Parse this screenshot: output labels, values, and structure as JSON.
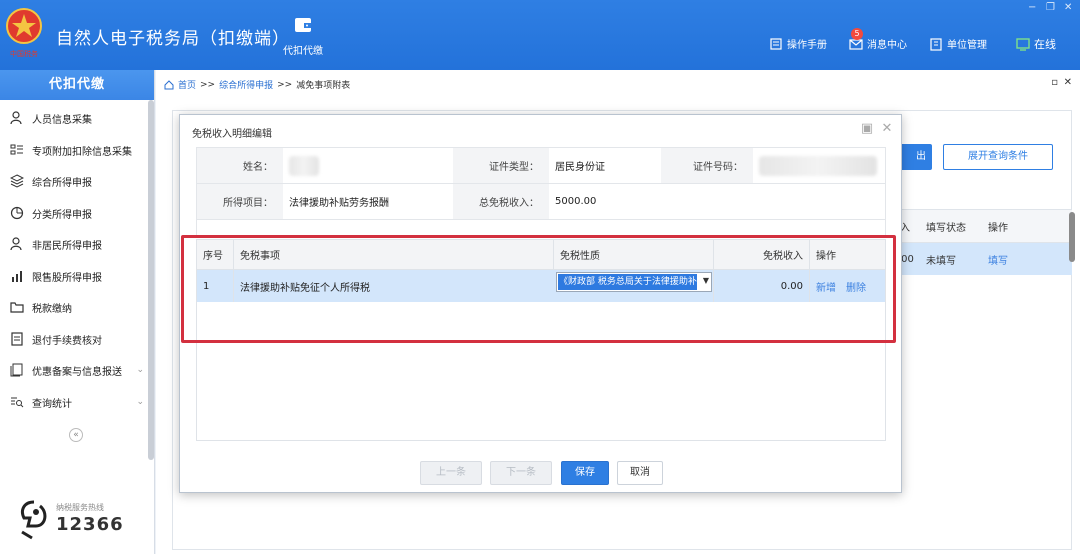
{
  "app": {
    "title": "自然人电子税务局（扣缴端）",
    "module": "代扣代缴",
    "emblem_text": "中国税务"
  },
  "header_links": [
    {
      "label": "操作手册",
      "icon": "book-icon"
    },
    {
      "label": "消息中心",
      "icon": "mail-icon",
      "badge": "5"
    },
    {
      "label": "单位管理",
      "icon": "building-icon"
    },
    {
      "label": "在线",
      "icon": "online-status-icon"
    }
  ],
  "sidebar": {
    "title": "代扣代缴",
    "items": [
      {
        "label": "人员信息采集",
        "icon": "person-icon"
      },
      {
        "label": "专项附加扣除信息采集",
        "icon": "list-icon"
      },
      {
        "label": "综合所得申报",
        "icon": "layers-icon"
      },
      {
        "label": "分类所得申报",
        "icon": "pie-icon"
      },
      {
        "label": "非居民所得申报",
        "icon": "person-icon"
      },
      {
        "label": "限售股所得申报",
        "icon": "chart-icon"
      },
      {
        "label": "税款缴纳",
        "icon": "folder-icon"
      },
      {
        "label": "退付手续费核对",
        "icon": "doc-icon"
      },
      {
        "label": "优惠备案与信息报送",
        "icon": "doc-stack-icon"
      },
      {
        "label": "查询统计",
        "icon": "search-list-icon"
      }
    ],
    "hotline_label": "纳税服务热线",
    "hotline_number": "12366"
  },
  "breadcrumb": {
    "home": "首页",
    "sep": ">>",
    "parent": "综合所得申报",
    "current": "减免事项附表"
  },
  "background": {
    "export_btn": "出",
    "expand_btn": "展开查询条件",
    "columns": [
      "入",
      "填写状态",
      "操作"
    ],
    "row": {
      "amount": ".00",
      "status": "未填写",
      "action": "填写"
    }
  },
  "modal": {
    "title": "免税收入明细编辑",
    "info": {
      "name_label": "姓名：",
      "id_type_label": "证件类型：",
      "id_type_value": "居民身份证",
      "id_no_label": "证件号码：",
      "income_item_label": "所得项目：",
      "income_item_value": "法律援助补贴劳务报酬",
      "total_label": "总免税收入：",
      "total_value": "5000.00"
    },
    "grid": {
      "columns": [
        "序号",
        "免税事项",
        "免税性质",
        "免税收入",
        "操作"
      ],
      "rows": [
        {
          "no": "1",
          "item": "法律援助补贴免征个人所得税",
          "nature": "《财政部 税务总局关于法律援助补贴有关税收政策的公告》",
          "amount": "0.00",
          "add": "新增",
          "del": "删除"
        }
      ]
    },
    "buttons": {
      "prev": "上一条",
      "next": "下一条",
      "save": "保存",
      "cancel": "取消"
    }
  },
  "colors": {
    "brand": "#2f7fe3",
    "highlight": "#d3303f",
    "selected_row": "#d3e6fb"
  }
}
